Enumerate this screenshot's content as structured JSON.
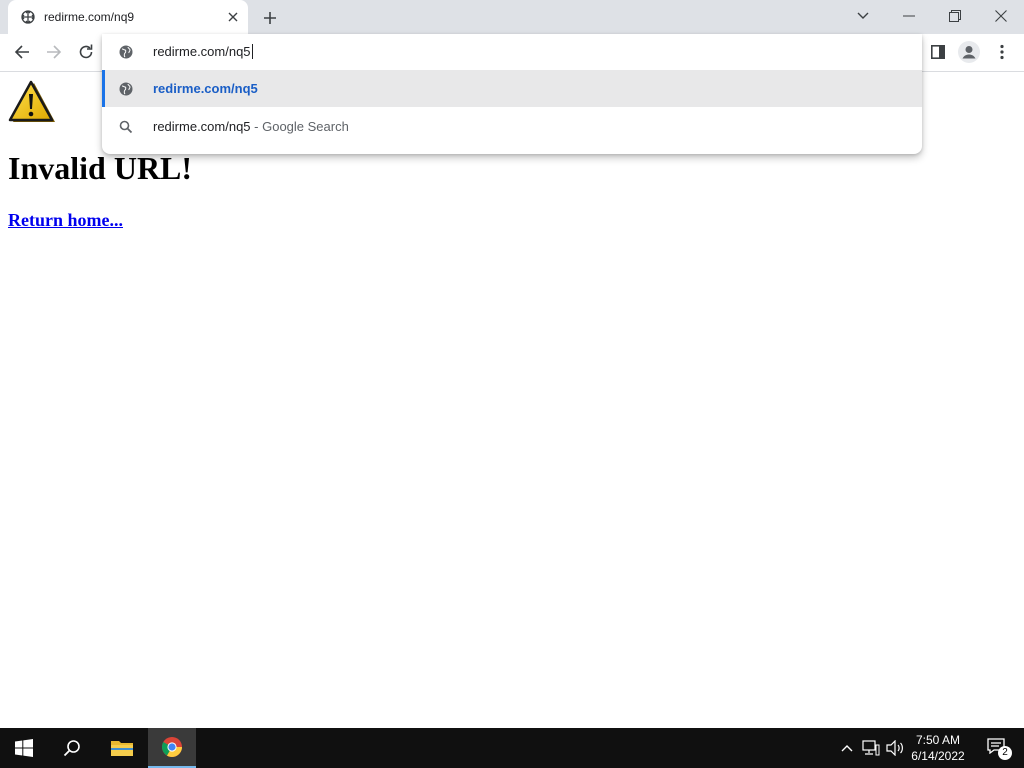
{
  "browser": {
    "tab_title": "redirme.com/nq9",
    "window_controls": [
      "tab-search",
      "minimize",
      "restore",
      "close"
    ]
  },
  "omnibox": {
    "input_value": "redirme.com/nq5",
    "suggestions": [
      {
        "icon": "globe-icon",
        "text": "redirme.com/nq5",
        "suffix": ""
      },
      {
        "icon": "search-icon",
        "text": "redirme.com/nq5",
        "suffix": " - Google Search"
      }
    ]
  },
  "page": {
    "heading": "Invalid URL!",
    "link_text": "Return home..."
  },
  "taskbar": {
    "time": "7:50 AM",
    "date": "6/14/2022",
    "notification_count": "2"
  },
  "colors": {
    "accent": "#1a73e8",
    "link": "#0000ee",
    "tabstrip": "#dee1e6",
    "taskbar": "#101010"
  }
}
